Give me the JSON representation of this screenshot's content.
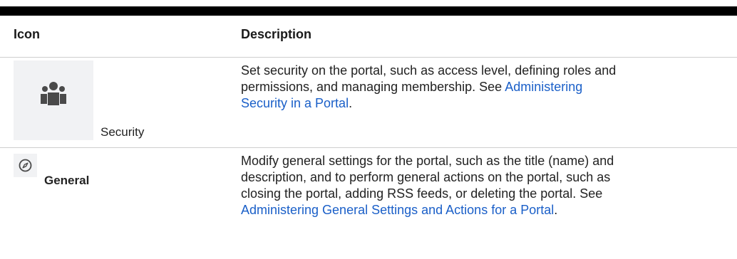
{
  "table": {
    "headers": {
      "icon": "Icon",
      "description": "Description"
    },
    "rows": [
      {
        "icon": "people-icon",
        "caption": "Security",
        "description_prefix": "Set security on the portal, such as access level, defining roles and permissions, and managing membership. See ",
        "link": "Administering Security in a Portal",
        "description_suffix": "."
      },
      {
        "icon": "compass-icon",
        "caption": "General",
        "description_prefix": "Modify general settings for the portal, such as the title (name) and description, and to perform general actions on the portal, such as closing the portal, adding RSS feeds, or deleting the portal. See ",
        "link": "Administering General Settings and Actions for a Portal",
        "description_suffix": "."
      }
    ]
  },
  "colors": {
    "link": "#1a5fc8",
    "text": "#222222",
    "icon_tile": "#f1f2f4",
    "icon_fill": "#4a4a4a"
  }
}
